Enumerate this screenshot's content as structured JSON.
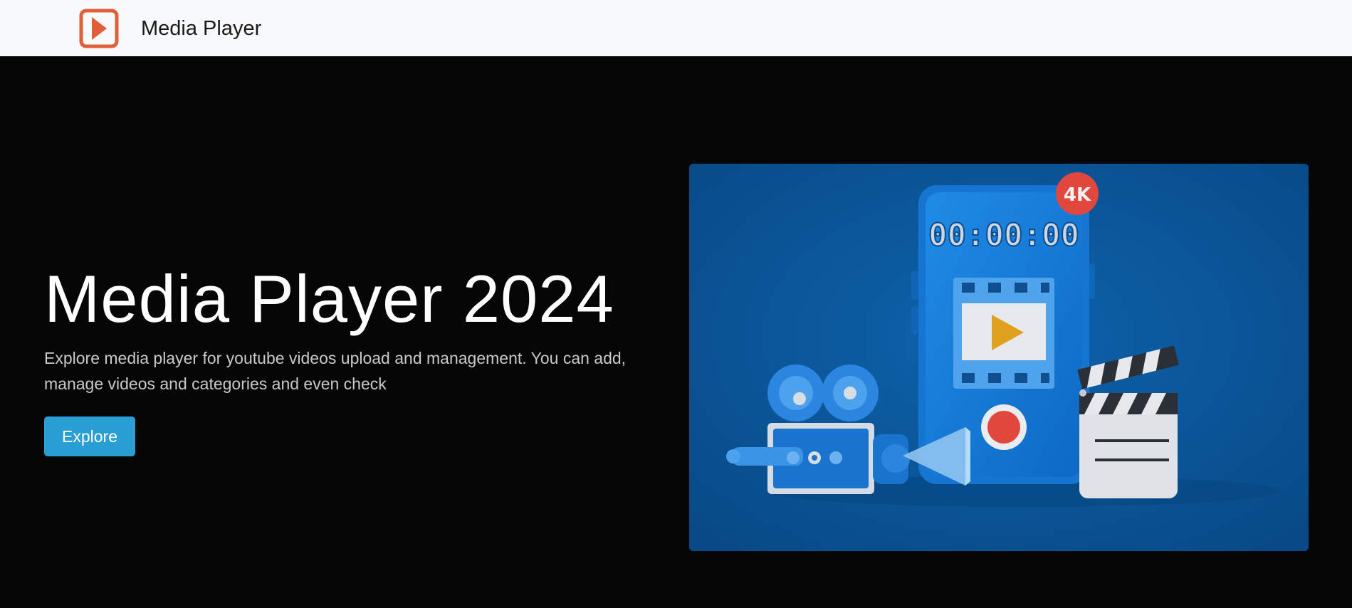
{
  "navbar": {
    "brand_name": "Media Player",
    "logo_icon": "play-icon",
    "logo_color": "#e0603a"
  },
  "hero": {
    "title": "Media Player 2024",
    "description": "Explore media player for youtube videos upload and management. You can add, manage videos and categories and even check",
    "explore_label": "Explore",
    "button_color": "#2a9fd6",
    "illustration": {
      "timer_text": "00:00:00",
      "badge_text": "4K",
      "background_color": "#0a5597"
    }
  }
}
